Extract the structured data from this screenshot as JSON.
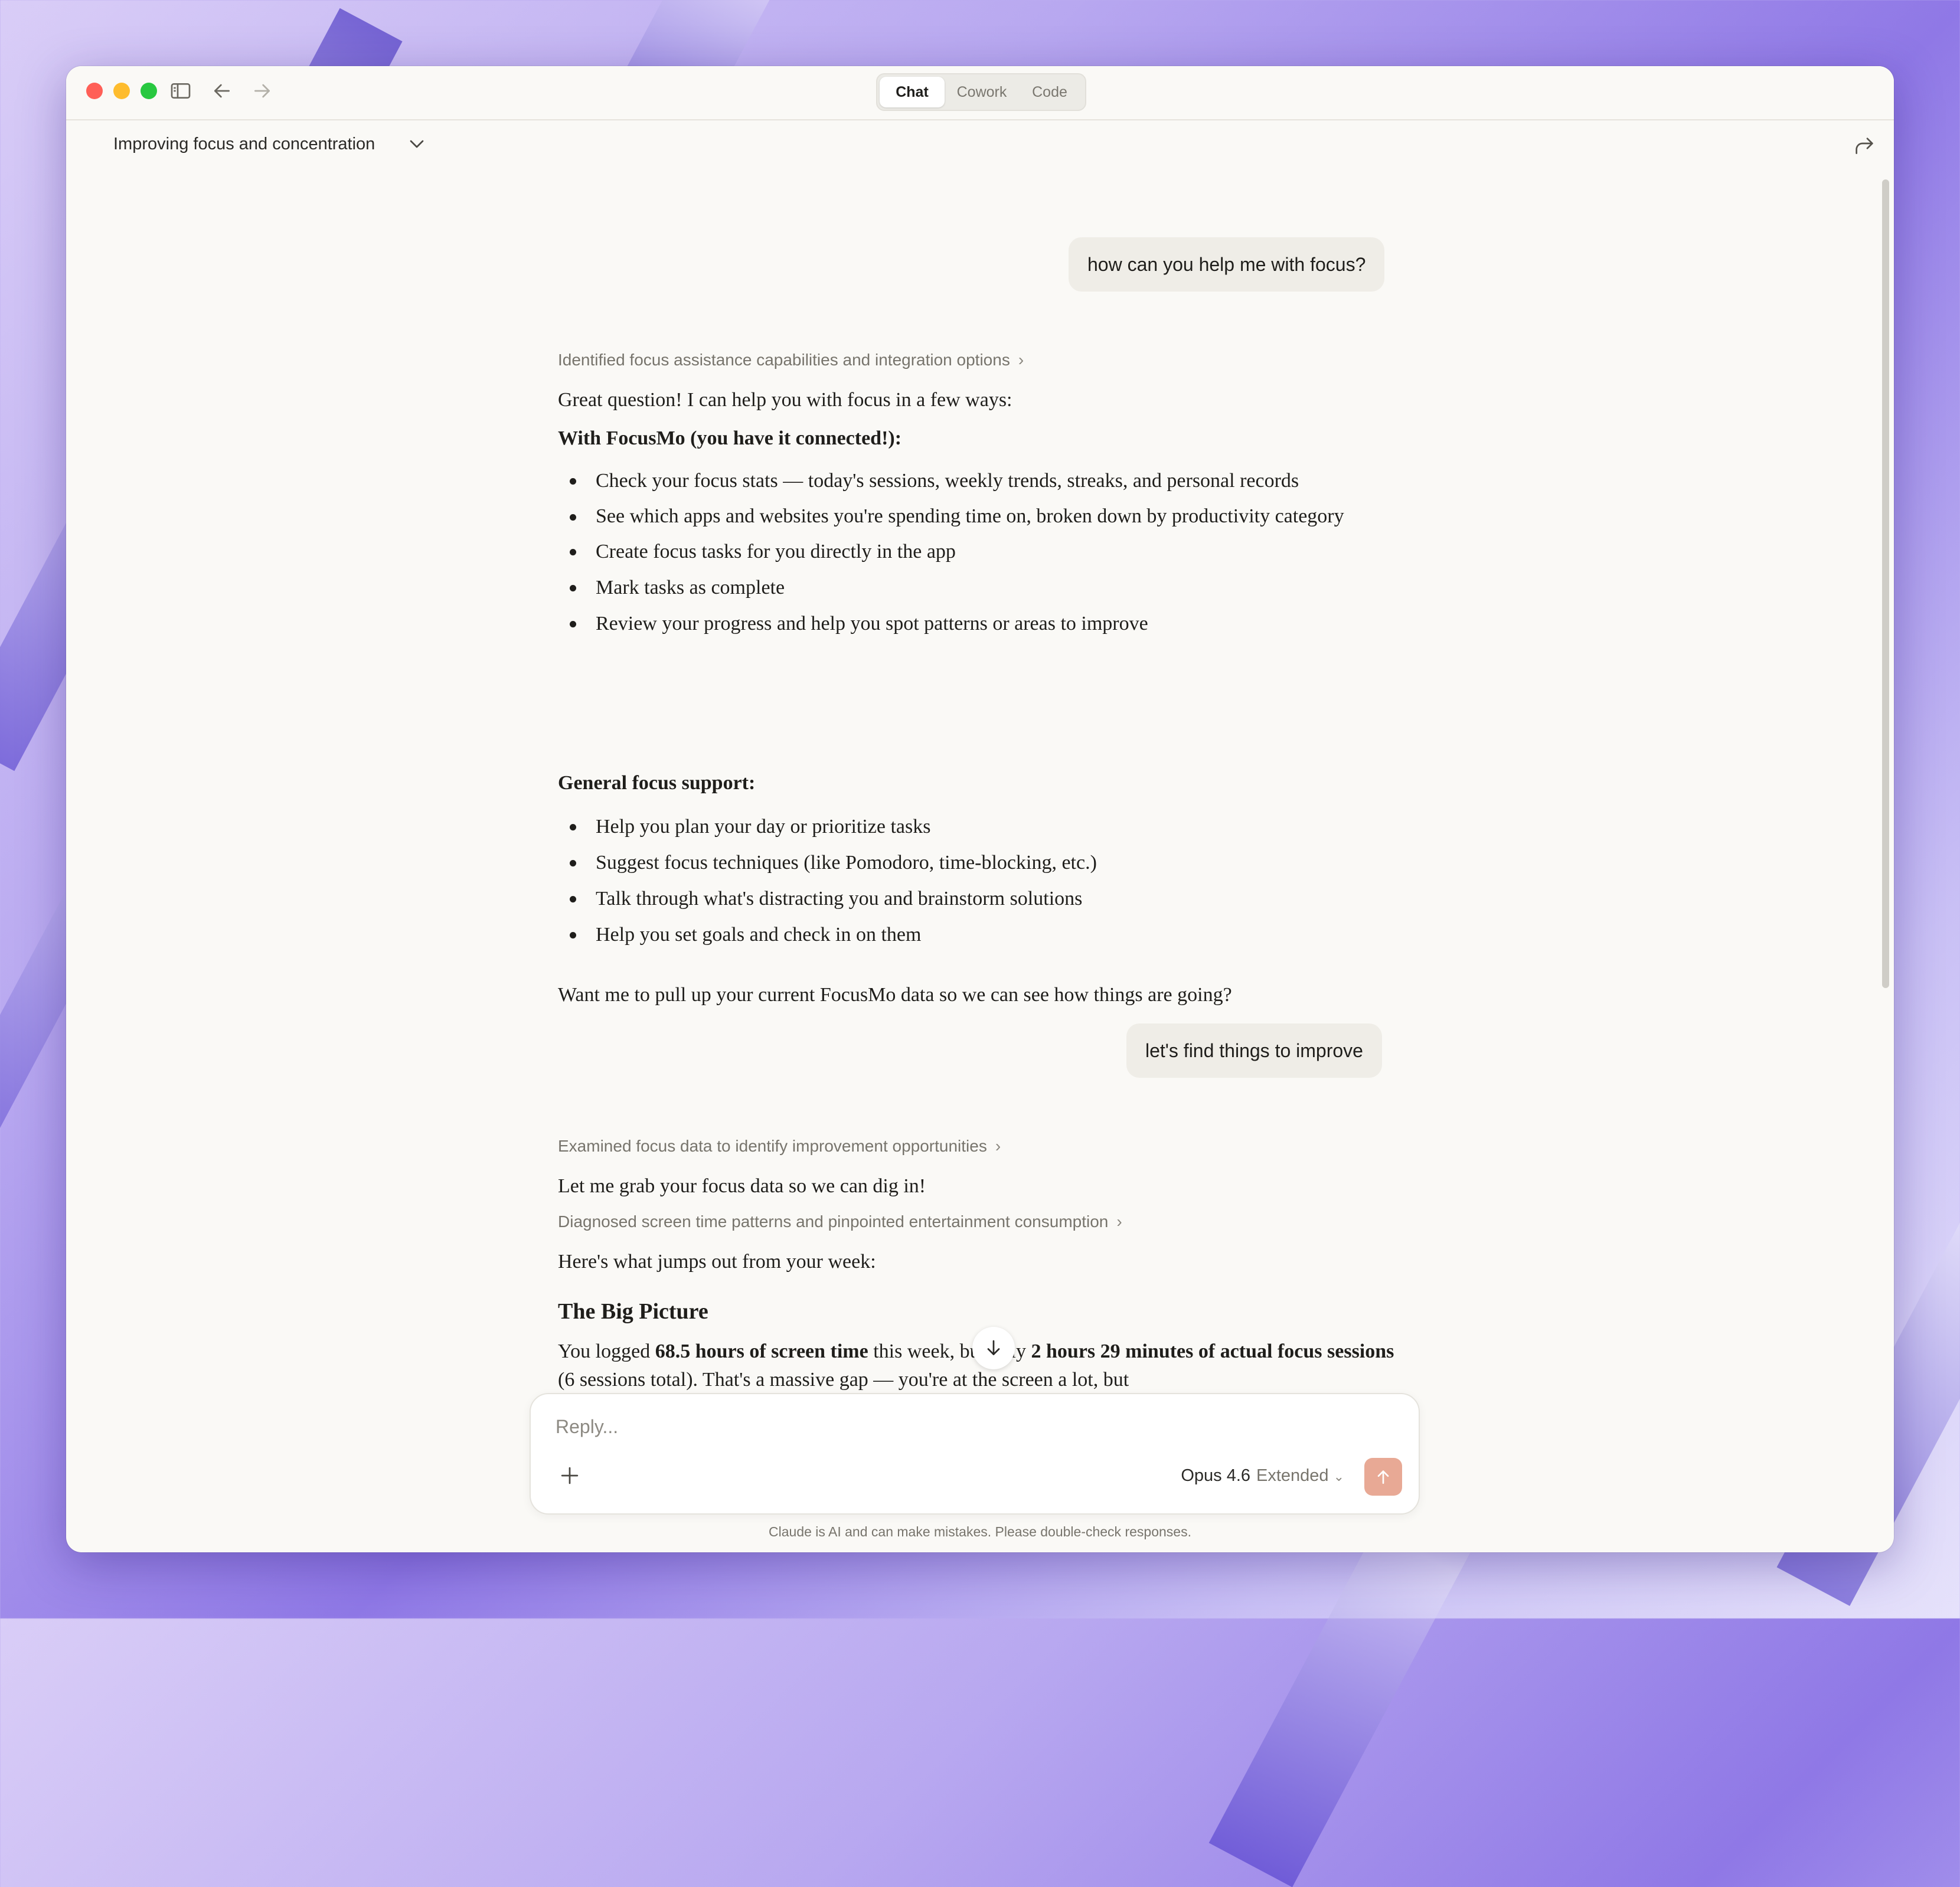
{
  "window": {
    "modes": [
      "Chat",
      "Cowork",
      "Code"
    ],
    "active_mode": "Chat"
  },
  "conversation": {
    "title": "Improving focus and concentration"
  },
  "messages": {
    "user1": "how can you help me with focus?",
    "thinking1": "Identified focus assistance capabilities and integration options",
    "a1_intro": "Great question! I can help you with focus in a few ways:",
    "a1_h1": "With FocusMo (you have it connected!):",
    "a1_list1": [
      "Check your focus stats — today's sessions, weekly trends, streaks, and personal records",
      "See which apps and websites you're spending time on, broken down by productivity category",
      "Create focus tasks for you directly in the app",
      "Mark tasks as complete",
      "Review your progress and help you spot patterns or areas to improve"
    ],
    "a1_h2": "General focus support:",
    "a1_list2": [
      "Help you plan your day or prioritize tasks",
      "Suggest focus techniques (like Pomodoro, time-blocking, etc.)",
      "Talk through what's distracting you and brainstorm solutions",
      "Help you set goals and check in on them"
    ],
    "a1_outro": "Want me to pull up your current FocusMo data so we can see how things are going?",
    "user2": "let's find things to improve",
    "thinking2": "Examined focus data to identify improvement opportunities",
    "a2_line1": "Let me grab your focus data so we can dig in!",
    "thinking3": "Diagnosed screen time patterns and pinpointed entertainment consumption",
    "a2_line2": "Here's what jumps out from your week:",
    "a2_heading": "The Big Picture",
    "a2_p1_a": "You logged ",
    "a2_p1_b": "68.5 hours of screen time",
    "a2_p1_c": " this week, but only ",
    "a2_p1_d": "2 hours 29 minutes of actual focus sessions",
    "a2_p1_e": " (6 sessions total). That's a massive gap — you're at the screen a lot, but"
  },
  "composer": {
    "placeholder": "Reply...",
    "model": "Opus 4.6",
    "mode": "Extended"
  },
  "footer": {
    "disclaimer": "Claude is AI and can make mistakes. Please double-check responses."
  },
  "colors": {
    "accent_send": "#e8a995",
    "bubble": "#efede7",
    "background": "#faf9f6"
  }
}
